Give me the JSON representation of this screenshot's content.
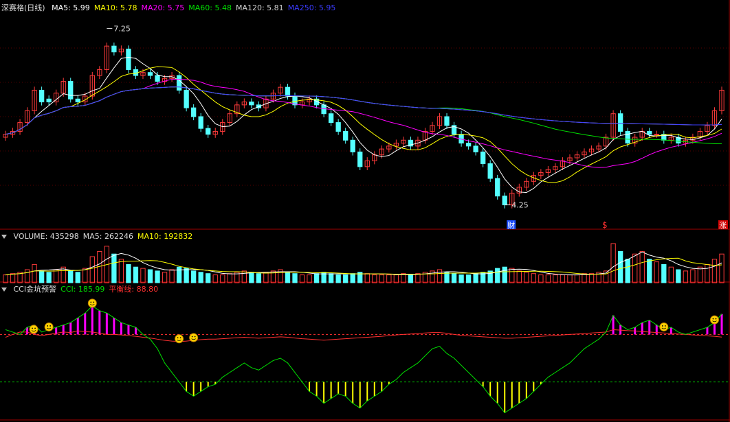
{
  "colors": {
    "up": "#ff3b3b",
    "down": "#54ffff",
    "ma5": "#ffffff",
    "ma10": "#ffff00",
    "ma20": "#ff00ff",
    "ma60": "#00e000",
    "ma120": "#d0d0d0",
    "ma250": "#3b3bff",
    "cci_line": "#00e000",
    "balance_line": "#ff3030",
    "gold_bar": "#ffff00",
    "magenta_bar": "#ff00ff"
  },
  "price_panel": {
    "title": "深赛格(日线)",
    "legend": [
      {
        "label": "MA5: 5.99",
        "color": "#ffffff"
      },
      {
        "label": "MA10: 5.78",
        "color": "#ffff00"
      },
      {
        "label": "MA20: 5.75",
        "color": "#ff00ff"
      },
      {
        "label": "MA60: 5.48",
        "color": "#00e000"
      },
      {
        "label": "MA120: 5.81",
        "color": "#d0d0d0"
      },
      {
        "label": "MA250: 5.95",
        "color": "#3b3bff"
      }
    ],
    "high_label": "7.25",
    "low_label": "4.25",
    "marker_cai": "财",
    "marker_dollar": "$",
    "marker_zhang": "涨"
  },
  "volume_panel": {
    "legend": [
      {
        "label": "VOLUME: 435298",
        "color": "#dddddd"
      },
      {
        "label": "MA5: 262246",
        "color": "#dddddd"
      },
      {
        "label": "MA10: 192832",
        "color": "#ffff00"
      }
    ]
  },
  "cci_panel": {
    "legend": [
      {
        "label": "CCI金坑预警",
        "color": "#dddddd"
      },
      {
        "label": "CCI: 185.99",
        "color": "#00e000"
      },
      {
        "label": "平衡线: 88.80",
        "color": "#ff3030"
      }
    ]
  },
  "chart_data": {
    "type": "candlestick",
    "price_range": [
      4.0,
      7.5
    ],
    "closes": [
      5.45,
      5.5,
      5.65,
      5.85,
      6.2,
      6.0,
      6.0,
      6.15,
      6.35,
      6.05,
      6.0,
      6.1,
      6.45,
      6.55,
      6.95,
      6.85,
      6.9,
      6.55,
      6.45,
      6.5,
      6.45,
      6.35,
      6.4,
      6.45,
      6.2,
      5.9,
      5.75,
      5.55,
      5.45,
      5.5,
      5.65,
      5.8,
      5.95,
      6.0,
      5.95,
      5.9,
      6.05,
      6.15,
      6.25,
      6.1,
      5.95,
      6.0,
      6.05,
      5.95,
      5.8,
      5.65,
      5.5,
      5.35,
      5.15,
      4.9,
      5.0,
      5.1,
      5.2,
      5.25,
      5.3,
      5.35,
      5.25,
      5.35,
      5.5,
      5.6,
      5.75,
      5.6,
      5.45,
      5.3,
      5.25,
      5.15,
      4.95,
      4.7,
      4.4,
      4.25,
      4.45,
      4.55,
      4.65,
      4.75,
      4.8,
      4.85,
      4.9,
      5.0,
      5.05,
      5.1,
      5.15,
      5.2,
      5.25,
      5.4,
      5.8,
      5.5,
      5.3,
      5.4,
      5.5,
      5.45,
      5.45,
      5.35,
      5.4,
      5.3,
      5.35,
      5.4,
      5.5,
      5.6,
      5.85,
      6.2
    ],
    "opens": [
      5.4,
      5.45,
      5.5,
      5.65,
      5.85,
      6.2,
      6.05,
      6.0,
      6.15,
      6.35,
      6.05,
      6.0,
      6.1,
      6.45,
      6.55,
      6.95,
      6.85,
      6.9,
      6.55,
      6.45,
      6.5,
      6.45,
      6.35,
      6.4,
      6.45,
      6.2,
      5.9,
      5.75,
      5.55,
      5.45,
      5.5,
      5.65,
      5.8,
      5.95,
      6.0,
      5.95,
      5.9,
      6.05,
      6.15,
      6.25,
      6.1,
      5.95,
      6.0,
      6.05,
      5.95,
      5.8,
      5.65,
      5.5,
      5.35,
      5.15,
      4.9,
      5.0,
      5.1,
      5.2,
      5.25,
      5.3,
      5.35,
      5.25,
      5.35,
      5.5,
      5.6,
      5.75,
      5.6,
      5.45,
      5.3,
      5.25,
      5.15,
      4.95,
      4.7,
      4.4,
      4.25,
      4.45,
      4.55,
      4.65,
      4.75,
      4.8,
      4.85,
      4.9,
      5.0,
      5.05,
      5.1,
      5.15,
      5.2,
      5.25,
      5.4,
      5.8,
      5.5,
      5.3,
      5.4,
      5.5,
      5.45,
      5.45,
      5.35,
      5.4,
      5.3,
      5.35,
      5.4,
      5.5,
      5.6,
      5.85
    ],
    "volumes": [
      30,
      35,
      40,
      50,
      70,
      45,
      40,
      50,
      60,
      45,
      40,
      55,
      100,
      120,
      140,
      110,
      90,
      70,
      60,
      55,
      50,
      45,
      40,
      50,
      60,
      55,
      45,
      40,
      35,
      30,
      30,
      35,
      40,
      45,
      40,
      35,
      40,
      45,
      50,
      40,
      35,
      30,
      30,
      35,
      40,
      35,
      30,
      30,
      35,
      40,
      35,
      30,
      30,
      30,
      30,
      35,
      30,
      35,
      40,
      45,
      50,
      40,
      35,
      30,
      30,
      35,
      40,
      45,
      55,
      60,
      55,
      45,
      40,
      35,
      30,
      30,
      30,
      30,
      30,
      30,
      35,
      35,
      40,
      45,
      150,
      120,
      90,
      110,
      120,
      90,
      80,
      70,
      60,
      50,
      45,
      50,
      60,
      70,
      90,
      110
    ],
    "cci": [
      120,
      110,
      100,
      130,
      140,
      110,
      120,
      130,
      140,
      150,
      170,
      190,
      220,
      200,
      190,
      170,
      150,
      140,
      130,
      100,
      80,
      40,
      -20,
      -60,
      -100,
      -140,
      -160,
      -140,
      -120,
      -110,
      -80,
      -60,
      -40,
      -20,
      -40,
      -50,
      -30,
      -10,
      0,
      -20,
      -60,
      -100,
      -140,
      -160,
      -190,
      -170,
      -150,
      -160,
      -190,
      -210,
      -180,
      -160,
      -140,
      -110,
      -90,
      -60,
      -40,
      -20,
      10,
      40,
      50,
      20,
      0,
      -30,
      -60,
      -90,
      -120,
      -160,
      -190,
      -230,
      -210,
      -190,
      -170,
      -140,
      -110,
      -80,
      -60,
      -40,
      -20,
      10,
      40,
      60,
      80,
      110,
      180,
      140,
      120,
      130,
      150,
      160,
      140,
      120,
      130,
      110,
      100,
      110,
      120,
      130,
      150,
      186
    ],
    "balance": [
      88,
      100,
      110,
      110,
      100,
      95,
      100,
      105,
      110,
      108,
      115,
      112,
      110,
      105,
      100,
      100,
      98,
      95,
      92,
      88,
      85,
      80,
      75,
      72,
      70,
      72,
      75,
      78,
      80,
      80,
      82,
      84,
      86,
      88,
      86,
      84,
      86,
      88,
      90,
      88,
      85,
      82,
      80,
      78,
      76,
      78,
      80,
      82,
      84,
      86,
      88,
      90,
      92,
      95,
      98,
      100,
      102,
      104,
      106,
      108,
      108,
      105,
      100,
      96,
      94,
      92,
      90,
      88,
      86,
      84,
      84,
      86,
      88,
      90,
      92,
      94,
      96,
      98,
      100,
      102,
      104,
      106,
      108,
      110,
      120,
      118,
      116,
      115,
      112,
      110,
      108,
      106,
      104,
      102,
      100,
      98,
      96,
      94,
      92,
      89
    ]
  }
}
